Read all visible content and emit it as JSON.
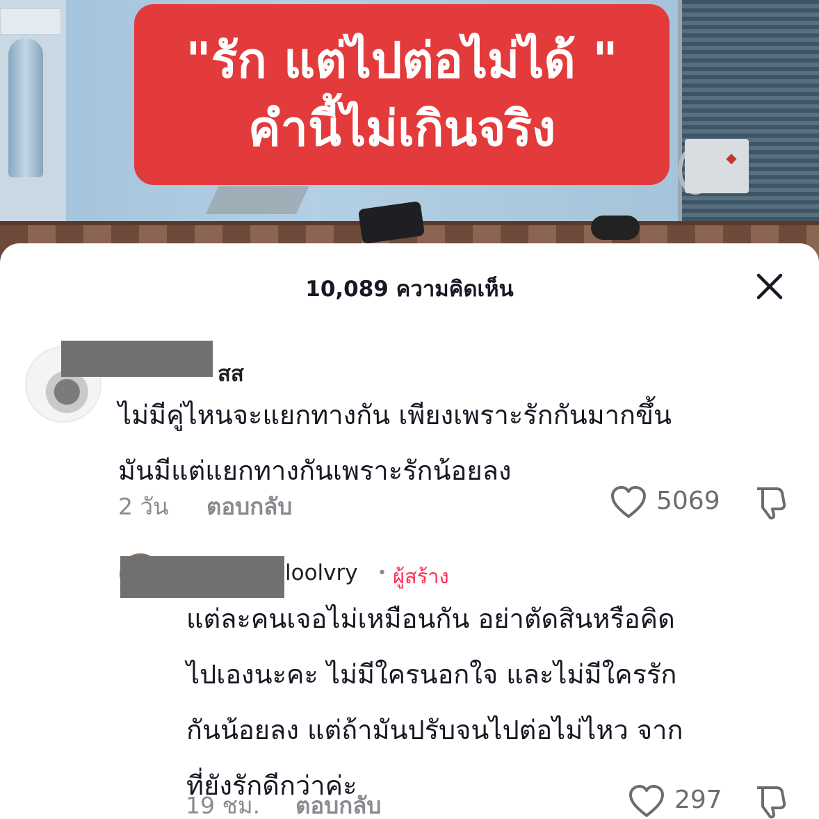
{
  "video": {
    "caption_line1": "\"รัก แต่ไปต่อไม่ได้ \"",
    "caption_line2": "คำนี้ไม่เกินจริง",
    "caption_bg_color": "#e33b3b"
  },
  "comments_panel": {
    "title": "10,089 ความคิดเห็น",
    "close_icon": "close-icon"
  },
  "comments": [
    {
      "username_suffix": "สส",
      "text_lines": [
        "ไม่มีคู่ไหนจะแยกทางกัน เพียงเพราะรักกันมากขึ้น",
        "มันมีแต่แยกทางกันเพราะรักน้อยลง"
      ],
      "time": "2 วัน",
      "reply_label": "ตอบกลับ",
      "likes": "5069"
    },
    {
      "username_suffix": "loolvry",
      "badge": "ผู้สร้าง",
      "text_lines": [
        "แต่ละคนเจอไม่เหมือนกัน อย่าตัดสินหรือคิด",
        "ไปเองนะคะ ไม่มีใครนอกใจ และไม่มีใครรัก",
        "กันน้อยลง แต่ถ้ามันปรับจนไปต่อไม่ไหว จาก",
        "ที่ยังรักดีกว่าค่ะ"
      ],
      "time": "19 ชม.",
      "reply_label": "ตอบกลับ",
      "likes": "297"
    }
  ],
  "colors": {
    "accent": "#fe2c55",
    "text_primary": "#161823",
    "text_secondary": "#8a8b91"
  }
}
